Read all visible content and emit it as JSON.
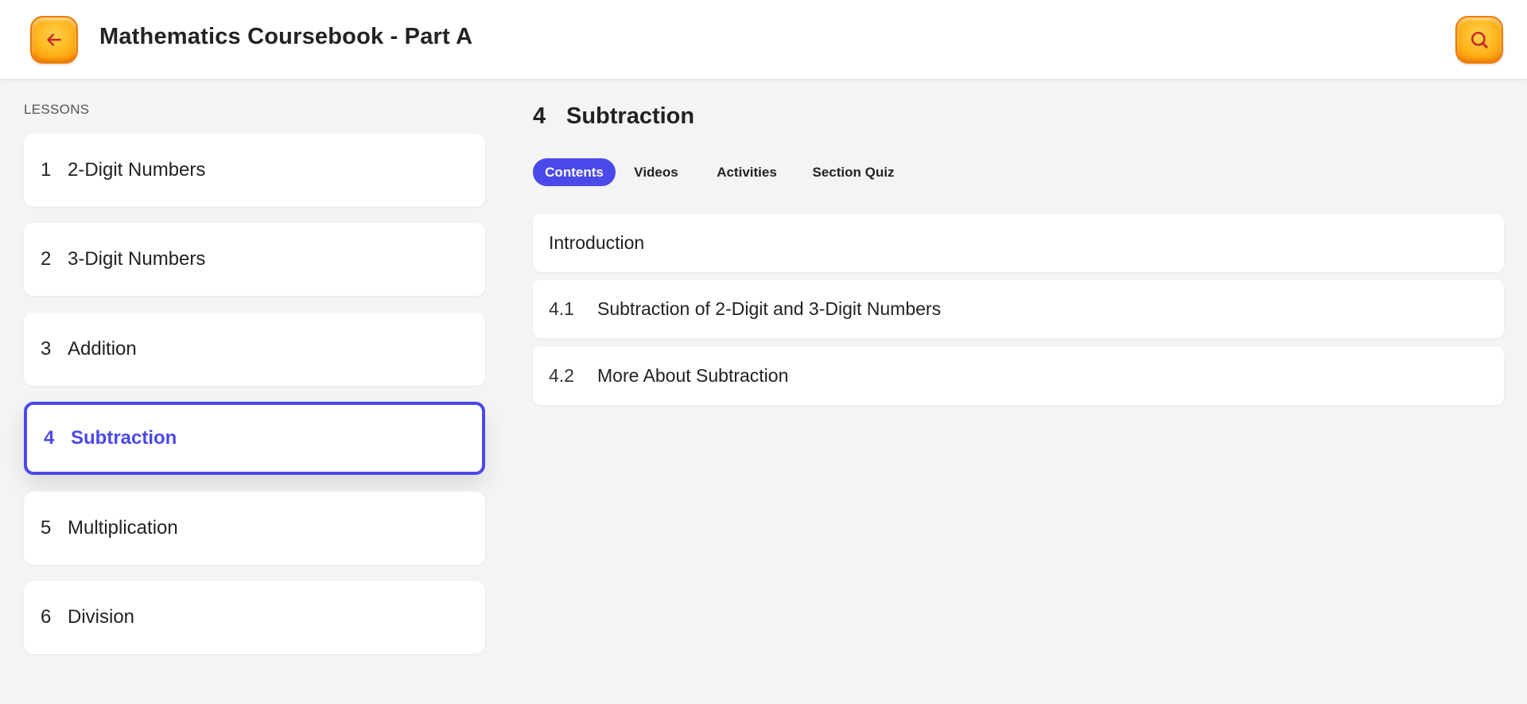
{
  "header": {
    "title": "Mathematics Coursebook - Part A",
    "back_icon": "arrow-left-icon",
    "search_icon": "search-icon",
    "accent_color": "#ffb31a",
    "icon_color": "#c62828"
  },
  "sidebar": {
    "label": "LESSONS",
    "lessons": [
      {
        "num": "1",
        "title": "2-Digit Numbers"
      },
      {
        "num": "2",
        "title": "3-Digit Numbers"
      },
      {
        "num": "3",
        "title": "Addition"
      },
      {
        "num": "4",
        "title": "Subtraction"
      },
      {
        "num": "5",
        "title": "Multiplication"
      },
      {
        "num": "6",
        "title": "Division"
      }
    ],
    "active_index": 3,
    "active_color": "#4b49e9"
  },
  "main": {
    "section_num": "4",
    "section_title": "Subtraction",
    "tabs": [
      {
        "label": "Contents"
      },
      {
        "label": "Videos"
      },
      {
        "label": "Activities"
      },
      {
        "label": "Section Quiz"
      }
    ],
    "active_tab": "Contents",
    "contents": [
      {
        "num": "",
        "title": "Introduction"
      },
      {
        "num": "4.1",
        "title": "Subtraction of 2-Digit and 3-Digit Numbers"
      },
      {
        "num": "4.2",
        "title": "More About Subtraction"
      }
    ]
  }
}
